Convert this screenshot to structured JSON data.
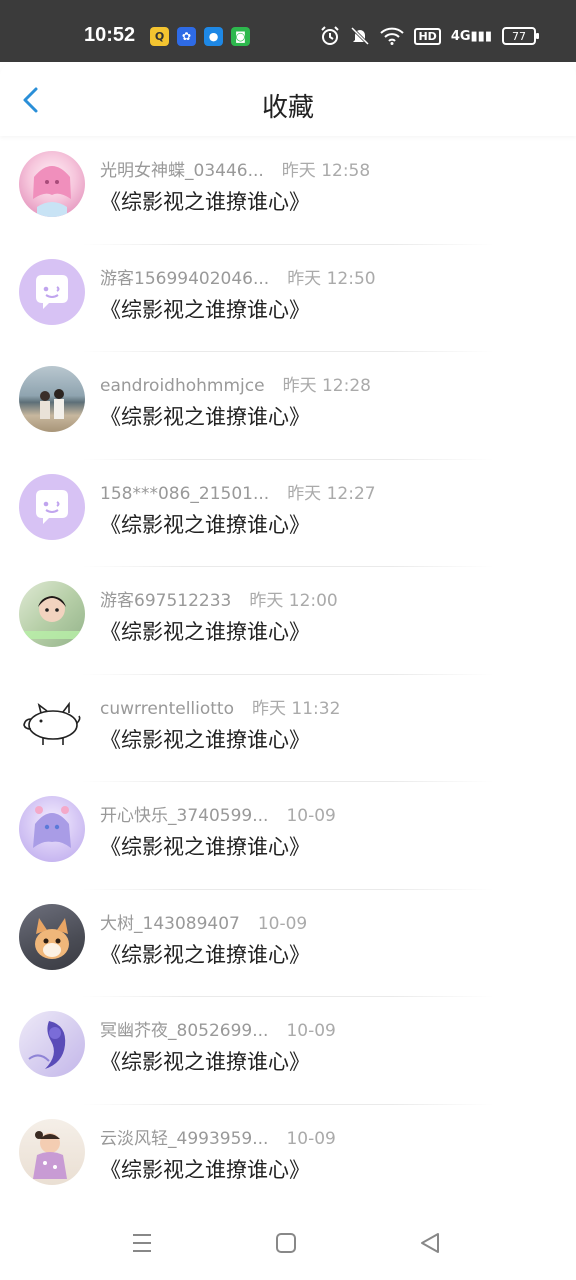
{
  "status_bar": {
    "time": "10:52",
    "hd": "HD",
    "network": "4G",
    "battery": "77",
    "app_icons": [
      {
        "name": "qq-icon",
        "color": "#f4c430"
      },
      {
        "name": "baidu-icon",
        "color": "#2e6be6"
      },
      {
        "name": "camera-app-icon",
        "color": "#1e88e5"
      },
      {
        "name": "wechat-icon",
        "color": "#2db84d"
      }
    ],
    "icons": [
      "alarm-icon",
      "mute-icon",
      "wifi-icon"
    ]
  },
  "header": {
    "title": "收藏",
    "back_icon": "chevron-left-icon",
    "accent": "#2a8fd8"
  },
  "items": [
    {
      "user": "光明女神蝶_03446...",
      "time": "昨天 12:58",
      "book": "《综影视之谁撩谁心》",
      "avatar": "anime-girl-pink"
    },
    {
      "user": "游客15699402046...",
      "time": "昨天 12:50",
      "book": "《综影视之谁撩谁心》",
      "avatar": "default-chat-bubble"
    },
    {
      "user": "eandroidhohmmjce",
      "time": "昨天 12:28",
      "book": "《综影视之谁撩谁心》",
      "avatar": "seaside-couple-photo"
    },
    {
      "user": "158***086_21501...",
      "time": "昨天 12:27",
      "book": "《综影视之谁撩谁心》",
      "avatar": "default-chat-bubble"
    },
    {
      "user": "游客697512233",
      "time": "昨天 12:00",
      "book": "《综影视之谁撩谁心》",
      "avatar": "child-photo"
    },
    {
      "user": "cuwrrentelliotto",
      "time": "昨天 11:32",
      "book": "《综影视之谁撩谁心》",
      "avatar": "pig-sketch"
    },
    {
      "user": "开心快乐_3740599...",
      "time": "10-09",
      "book": "《综影视之谁撩谁心》",
      "avatar": "anime-girl-blue"
    },
    {
      "user": "大树_143089407",
      "time": "10-09",
      "book": "《综影视之谁撩谁心》",
      "avatar": "kitten-photo"
    },
    {
      "user": "冥幽芥夜_8052699...",
      "time": "10-09",
      "book": "《综影视之谁撩谁心》",
      "avatar": "anime-purple-silhouette"
    },
    {
      "user": "云淡风轻_4993959...",
      "time": "10-09",
      "book": "《综影视之谁撩谁心》",
      "avatar": "baby-photo"
    }
  ],
  "nav_bar": {
    "icons": [
      "menu-icon",
      "home-square-icon",
      "back-triangle-icon"
    ]
  }
}
